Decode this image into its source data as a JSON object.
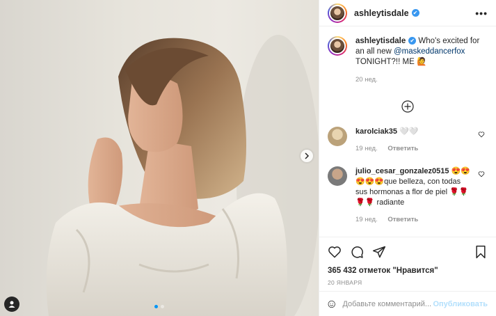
{
  "post": {
    "author": "ashleytisdale",
    "verified_mark": "✔",
    "more_label": "•••",
    "photo_alt": "",
    "carousel": {
      "total": 2,
      "current": 1
    }
  },
  "caption": {
    "username": "ashleytisdale",
    "text_before": " Who's excited for an all new ",
    "mention": "@maskeddancerfox",
    "text_after": " TONIGHT?!! ME 🙋",
    "time": "20 нед."
  },
  "comments": [
    {
      "username": "karolciak35",
      "text": " 🤍🤍",
      "time": "19 нед.",
      "reply": "Ответить"
    },
    {
      "username": "julio_cesar_gonzalez0515",
      "text": " 😍😍😍😍😍que belleza, con todas sus hormonas a flor de piel 🌹🌹🌹🌹 radiante",
      "time": "19 нед.",
      "reply": "Ответить"
    }
  ],
  "likes": "365 432 отметок \"Нравится\"",
  "date": "20 ЯНВАРЯ",
  "add_comment": {
    "placeholder": "Добавьте комментарий...",
    "post_label": "Опубликовать"
  },
  "colors": {
    "link": "#00376b",
    "accent": "#0095f6",
    "muted": "#8e8e8e",
    "post_disabled": "#b2dffc"
  },
  "icons": [
    "more-options-icon",
    "load-more-comments-icon",
    "heart-icon",
    "comment-icon",
    "share-icon",
    "bookmark-icon",
    "emoji-icon",
    "next-arrow-icon",
    "user-tag-icon"
  ]
}
